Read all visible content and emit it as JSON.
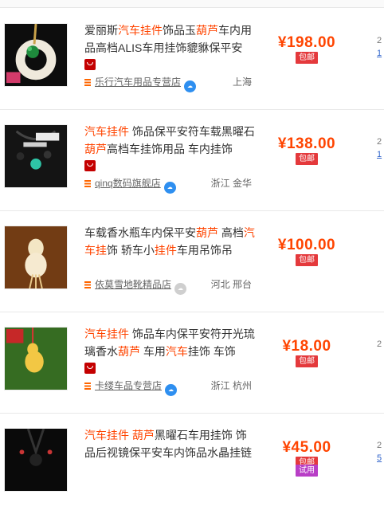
{
  "items": [
    {
      "title_parts": [
        {
          "text": "爱丽斯",
          "hl": false
        },
        {
          "text": "汽车挂件",
          "hl": true
        },
        {
          "text": "饰品玉",
          "hl": false
        },
        {
          "text": "葫芦",
          "hl": true
        },
        {
          "text": "车内用品高档ALIS车用挂饰貔貅保平安",
          "hl": false
        }
      ],
      "price": "¥198.00",
      "badges": [
        "包邮"
      ],
      "shop": "乐行汽车用品专营店",
      "location": "上海",
      "right_top": "2",
      "right_link": "1",
      "wang_gray": false
    },
    {
      "title_parts": [
        {
          "text": "汽车挂件",
          "hl": true
        },
        {
          "text": " 饰品保平安符车载黑曜石",
          "hl": false
        },
        {
          "text": "葫芦",
          "hl": true
        },
        {
          "text": "高档车挂饰用品 车内挂饰",
          "hl": false
        }
      ],
      "price": "¥138.00",
      "badges": [
        "包邮"
      ],
      "shop": "qinq数码旗舰店",
      "location": "浙江 金华",
      "right_top": "2",
      "right_link": "1",
      "wang_gray": false
    },
    {
      "title_parts": [
        {
          "text": "车载香水瓶车内保平安",
          "hl": false
        },
        {
          "text": "葫芦",
          "hl": true
        },
        {
          "text": " 高档",
          "hl": false
        },
        {
          "text": "汽车挂",
          "hl": true
        },
        {
          "text": "饰 轿车小",
          "hl": false
        },
        {
          "text": "挂件",
          "hl": true
        },
        {
          "text": "车用吊饰吊",
          "hl": false
        }
      ],
      "price": "¥100.00",
      "badges": [
        "包邮"
      ],
      "shop": "依莫雪地靴精品店",
      "location": "河北 邢台",
      "right_top": "",
      "right_link": "",
      "wang_gray": true
    },
    {
      "title_parts": [
        {
          "text": "汽车挂件",
          "hl": true
        },
        {
          "text": " 饰品车内保平安符开光琉璃香水",
          "hl": false
        },
        {
          "text": "葫芦",
          "hl": true
        },
        {
          "text": " 车用",
          "hl": false
        },
        {
          "text": "汽车",
          "hl": true
        },
        {
          "text": "挂饰 车饰",
          "hl": false
        }
      ],
      "price": "¥18.00",
      "badges": [
        "包邮"
      ],
      "shop": "卡缕车品专营店",
      "location": "浙江 杭州",
      "right_top": "2",
      "right_link": "",
      "wang_gray": false
    },
    {
      "title_parts": [
        {
          "text": "汽车挂件",
          "hl": true
        },
        {
          "text": " ",
          "hl": false
        },
        {
          "text": "葫芦",
          "hl": true
        },
        {
          "text": "黑曜石车用挂饰 饰品后视镜保平安车内饰品水晶挂链",
          "hl": false
        }
      ],
      "price": "¥45.00",
      "badges": [
        "包邮",
        "试用"
      ],
      "shop": "",
      "location": "",
      "right_top": "2",
      "right_link": "5",
      "wang_gray": false
    }
  ],
  "colors": {
    "accent": "#ff4400",
    "badge": "#e4393c",
    "trial": "#b83ec6",
    "link": "#3366cc"
  }
}
